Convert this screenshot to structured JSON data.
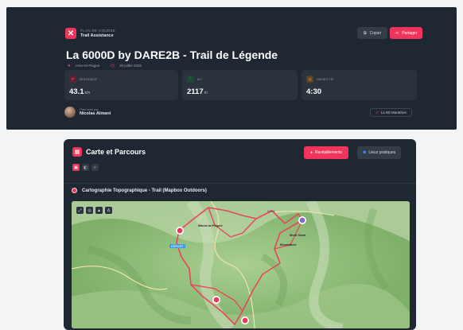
{
  "header": {
    "brand_kicker": "PLAN DE COURSE",
    "brand_name": "Trail Assistance",
    "copy_label": "Copier",
    "share_label": "Partager",
    "race_title": "La 6000D by DARE2B - Trail de Légende",
    "location": "Aime-la-Plagne",
    "date": "30 juillet 2026"
  },
  "stats": [
    {
      "label": "DISTANCE",
      "value": "43.1",
      "unit": "km",
      "icon": "route-icon",
      "color": "#f0345b"
    },
    {
      "label": "D+",
      "value": "2117",
      "unit": "m",
      "icon": "elevation-icon",
      "color": "#2bbf6a"
    },
    {
      "label": "OBJECTIF",
      "value": "4:30",
      "unit": "",
      "icon": "target-icon",
      "color": "#f5a623"
    }
  ],
  "creator": {
    "label": "Plan créé par",
    "name": "Nicolas Almani",
    "race_link": "La 6D Marathon"
  },
  "map_card": {
    "title": "Carte et Parcours",
    "ravito_label": "Ravitaillements",
    "lieux_label": "Lieux pratiques",
    "carto_title": "Cartographie Topographique - Trail (Mapbox Outdoors)",
    "labels": {
      "town1": "Mâcot-la-Plagne",
      "town2": "Montalbert",
      "start": "DÉPART",
      "peak": "Mont Saint",
      "road": "D221"
    }
  },
  "colors": {
    "accent": "#f0345b",
    "bg_dark": "#1f2732",
    "panel": "#2a323e"
  }
}
